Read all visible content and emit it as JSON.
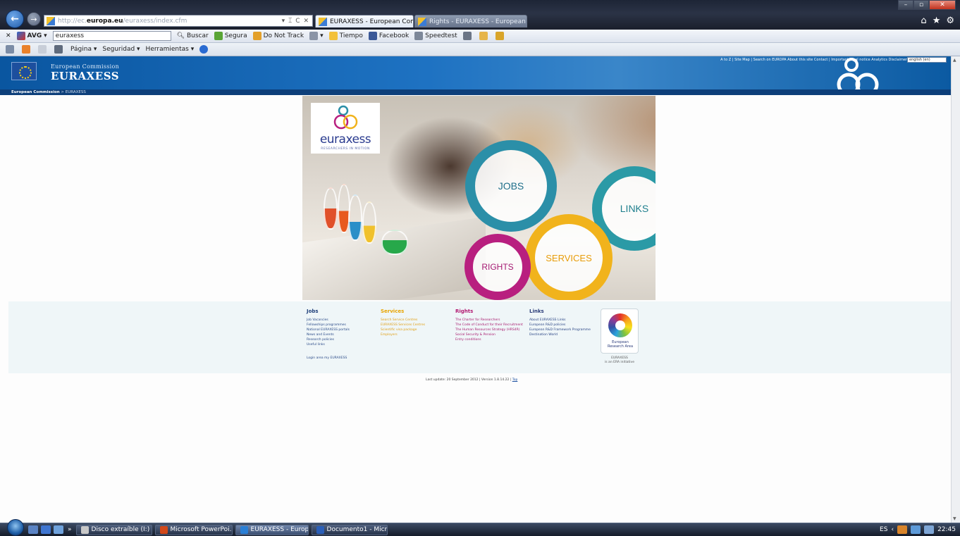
{
  "browser": {
    "address": {
      "prefix": "http://ec.",
      "host": "europa.eu",
      "path": "/euraxess/index.cfm",
      "controls": "▾ ⌶ C ✕"
    },
    "tabs": [
      {
        "label": "EURAXESS - European Com...",
        "active": true
      },
      {
        "label": "Rights - EURAXESS - European ...",
        "active": false
      }
    ],
    "window_controls": [
      "–",
      "▫",
      "✕"
    ],
    "chrome_icons": [
      "home-icon",
      "star-icon",
      "gear-icon"
    ]
  },
  "avg_toolbar": {
    "close": "✕",
    "brand": "AVG",
    "dropdown": "▾",
    "search_value": "euraxess",
    "search_button": "Buscar",
    "items": [
      "Segura",
      "Do Not Track",
      "Tiempo",
      "Facebook",
      "Speedtest"
    ]
  },
  "command_bar": {
    "items": [
      "Página ▾",
      "Seguridad ▾",
      "Herramientas ▾"
    ]
  },
  "ec_header": {
    "commission": "European Commission",
    "site": "EURAXESS",
    "top_links": "A to Z | Site Map | Search on EUROPA  About this site  Contact | Important legal notice  Analytics Disclaimer",
    "language": "english (en)"
  },
  "breadcrumb": {
    "root": "European Commission",
    "sep": " > ",
    "current": "EURAXESS"
  },
  "hero": {
    "logo_text": "euraxess",
    "logo_tagline": "RESEARCHERS IN MOTION",
    "rings": {
      "jobs": "JOBS",
      "links": "LINKS",
      "rights": "RIGHTS",
      "services": "SERVICES"
    }
  },
  "footer": {
    "jobs": {
      "title": "Jobs",
      "links": [
        "Job Vacancies",
        "Fellowships programmes",
        "National EURAXESS portals",
        "News and Events",
        "Research policies",
        "Useful links"
      ],
      "login": "Login area my EURAXESS"
    },
    "services": {
      "title": "Services",
      "links": [
        "Search Service Centres",
        "EURAXESS Services Centres",
        "Scientific visa package",
        "Employers"
      ]
    },
    "rights": {
      "title": "Rights",
      "links": [
        "The Charter for Researchers",
        "The Code of Conduct for their Recruitment",
        "The Human Resources Strategy (HRS4R)",
        "Social Security & Pension",
        "Entry conditions"
      ]
    },
    "links": {
      "title": "Links",
      "links": [
        "About EURAXESS Links",
        "European R&D policies",
        "European R&D Framework Programme",
        "Destination World"
      ]
    },
    "era": {
      "label_1": "European",
      "label_2": "Research Area",
      "caption_1": "EURAXESS",
      "caption_2": "is an ERA initiative"
    }
  },
  "last_update": {
    "text": "Last update: 20 September 2012 | Version 1.8.14.22 | ",
    "top": "Top"
  },
  "taskbar": {
    "tasks": [
      {
        "label": "Disco extraíble (I:)",
        "color": "#c8c8c8"
      },
      {
        "label": "Microsoft PowerPoi...",
        "color": "#d2491a"
      },
      {
        "label": "EURAXESS - Europe...",
        "color": "#2a7fd5"
      },
      {
        "label": "Documento1 - Micr...",
        "color": "#2b5fb8"
      }
    ],
    "lang": "ES",
    "time": "22:45"
  },
  "colors": {
    "jobs": "#2b8fa8",
    "links": "#2b9aa6",
    "rights": "#b81f7f",
    "services": "#f1b31c",
    "ec_blue": "#0a56a0"
  }
}
